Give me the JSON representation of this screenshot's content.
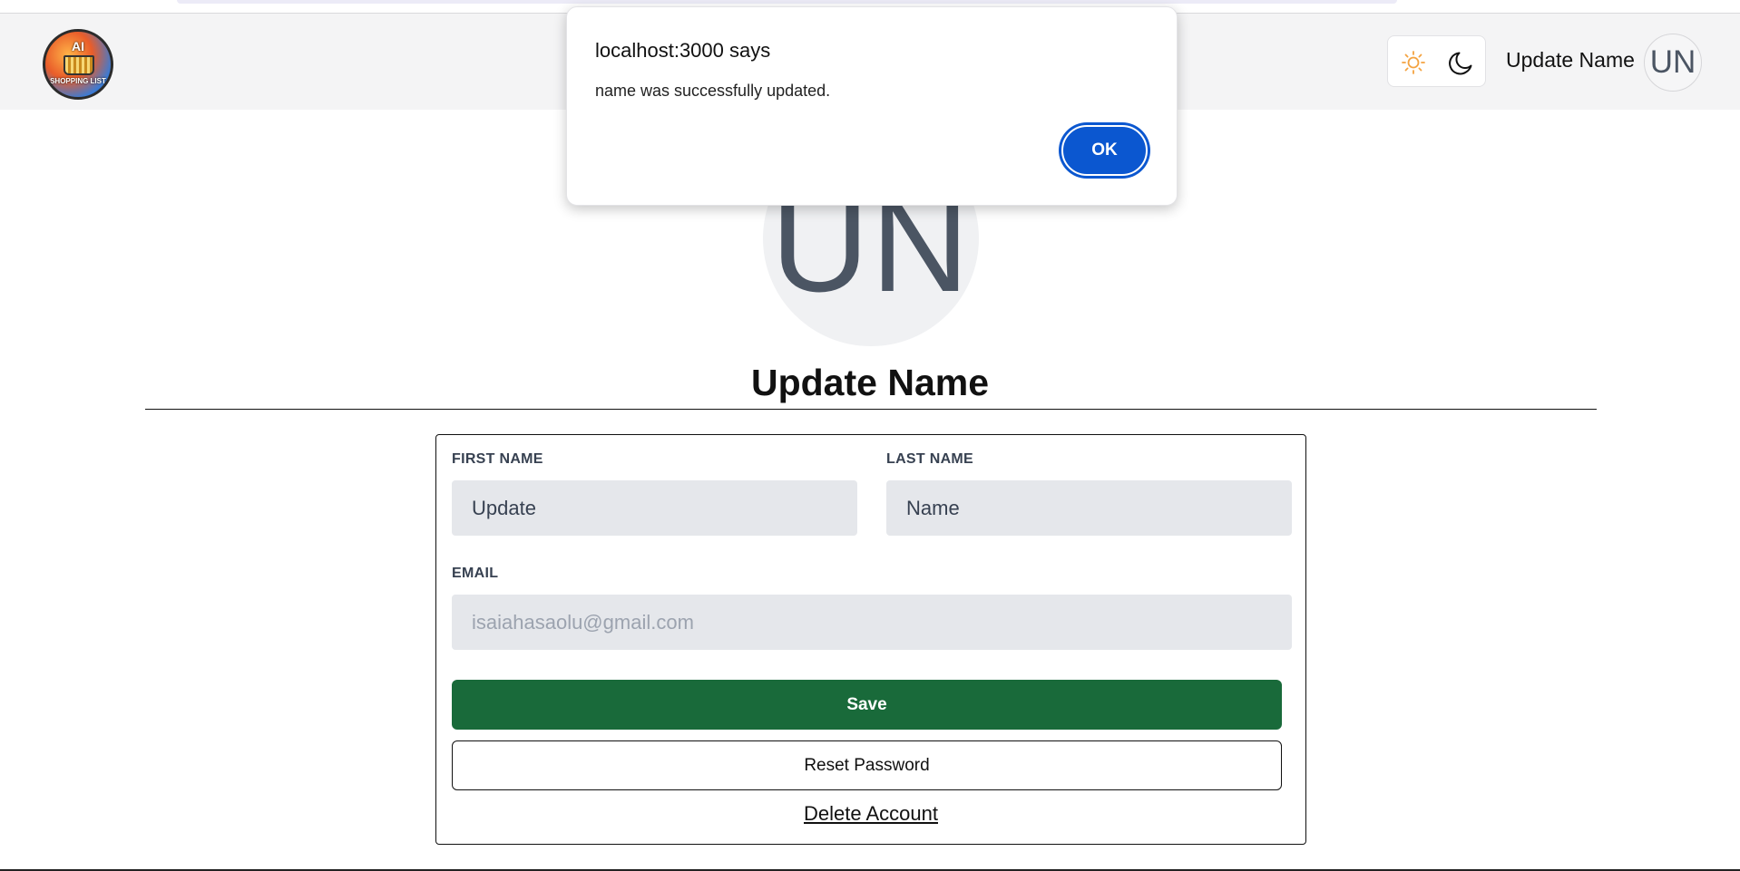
{
  "header": {
    "logo_text_top": "AI",
    "logo_text_bottom": "SHOPPING LIST",
    "user_name": "Update Name",
    "avatar_initials": "UN"
  },
  "profile": {
    "avatar_initials": "UN",
    "title": "Update Name"
  },
  "form": {
    "first_name_label": "FIRST NAME",
    "first_name_value": "Update",
    "last_name_label": "LAST NAME",
    "last_name_value": "Name",
    "email_label": "EMAIL",
    "email_value": "isaiahasaolu@gmail.com",
    "save_label": "Save",
    "reset_label": "Reset Password",
    "delete_label": "Delete Account"
  },
  "alert": {
    "title": "localhost:3000 says",
    "message": "name was successfully updated.",
    "ok_label": "OK"
  },
  "colors": {
    "save_button": "#196a3a",
    "ok_button": "#0b57d0",
    "sun_icon": "#f4a340"
  },
  "icons": [
    "sun-icon",
    "moon-icon"
  ]
}
